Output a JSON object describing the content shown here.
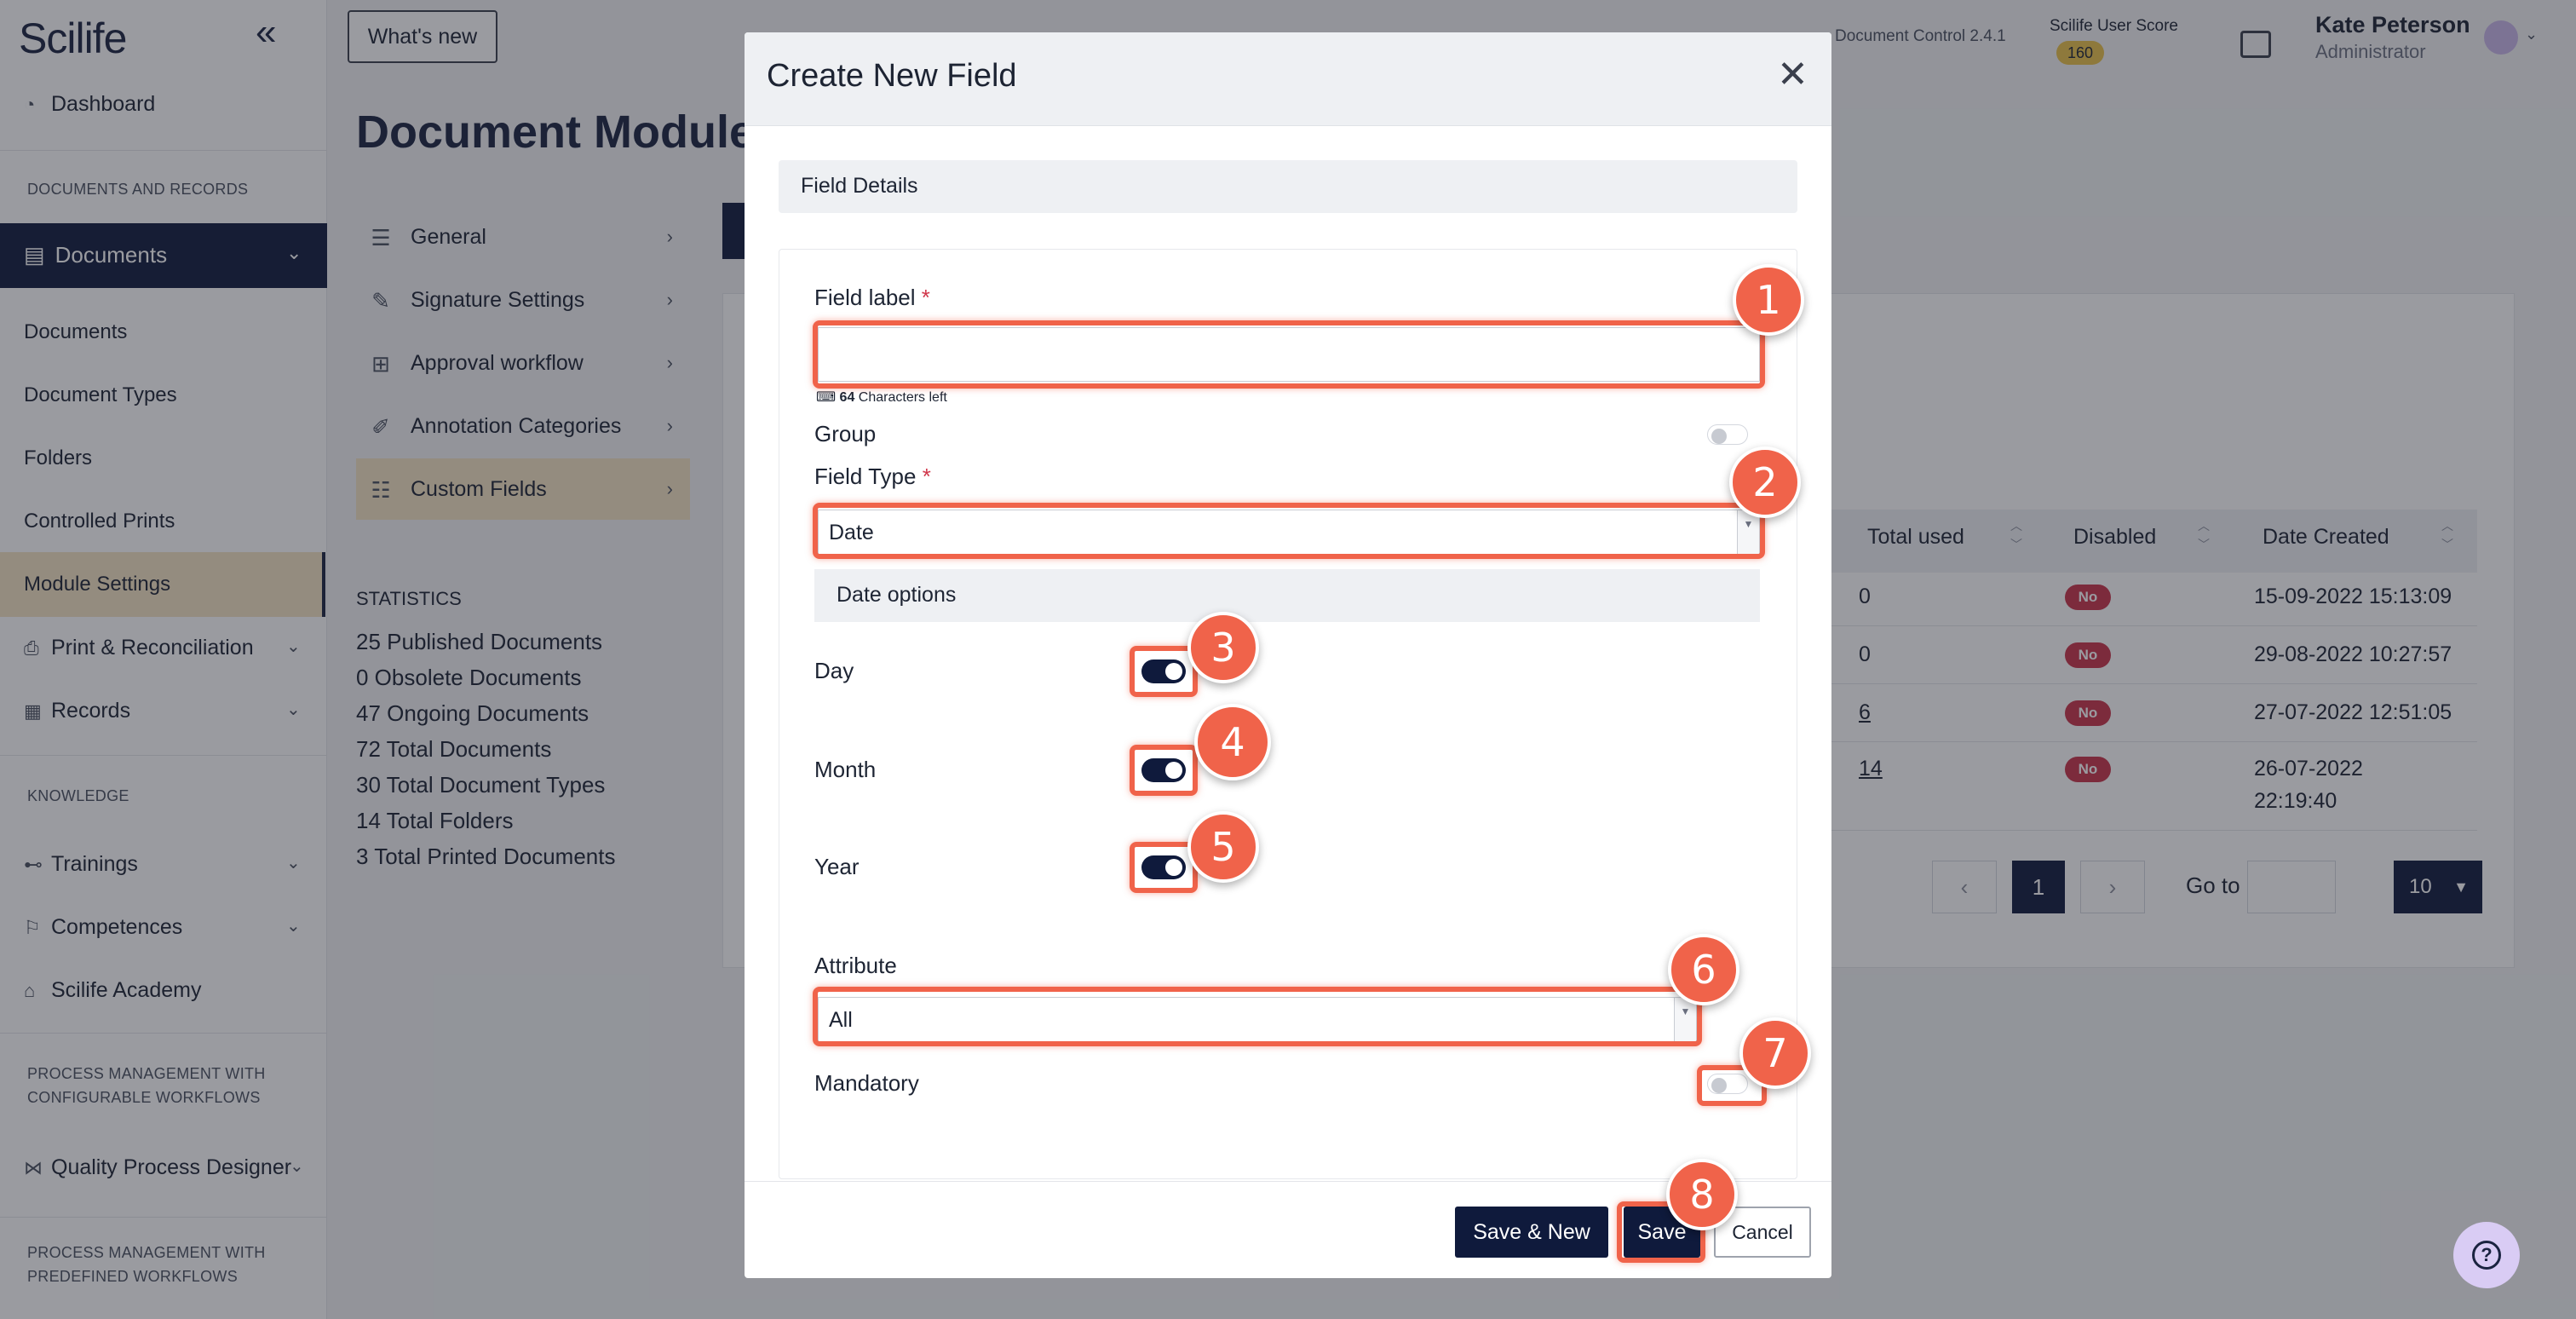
{
  "sidebar": {
    "logo": "Scilife",
    "dashboard": "Dashboard",
    "section_docs": "DOCUMENTS AND RECORDS",
    "documents_group": "Documents",
    "sub_items": [
      "Documents",
      "Document Types",
      "Folders",
      "Controlled Prints",
      "Module Settings"
    ],
    "print_reconciliation": "Print & Reconciliation",
    "records": "Records",
    "section_knowledge": "KNOWLEDGE",
    "trainings": "Trainings",
    "competences": "Competences",
    "academy": "Scilife Academy",
    "section_process_config": "PROCESS MANAGEMENT WITH CONFIGURABLE WORKFLOWS",
    "quality_process_designer": "Quality Process Designer",
    "section_process_predefined": "PROCESS MANAGEMENT WITH PREDEFINED WORKFLOWS"
  },
  "header": {
    "whats_new": "What's new",
    "version": "Document Control 2.4.1",
    "user_score_label": "Scilife User Score",
    "user_score": "160",
    "user_name": "Kate Peterson",
    "user_role": "Administrator"
  },
  "page": {
    "title": "Document Module",
    "settings_menu": [
      "General",
      "Signature Settings",
      "Approval workflow",
      "Annotation Categories",
      "Custom Fields"
    ],
    "stats_title": "STATISTICS",
    "stats": [
      "25  Published Documents",
      "0  Obsolete Documents",
      "47  Ongoing Documents",
      "72  Total Documents",
      "30  Total Document Types",
      "14  Total Folders",
      "3  Total Printed Documents"
    ],
    "table": {
      "headers": [
        "Total used",
        "Disabled",
        "Date Created"
      ],
      "rows": [
        {
          "total_used": "0",
          "disabled": "No",
          "date_created": "15-09-2022 15:13:09"
        },
        {
          "total_used": "0",
          "disabled": "No",
          "date_created": "29-08-2022 10:27:57"
        },
        {
          "total_used": "6",
          "disabled": "No",
          "date_created": "27-07-2022 12:51:05"
        },
        {
          "total_used": "14",
          "disabled": "No",
          "date_created": "26-07-2022",
          "date_created_2": "22:19:40"
        }
      ]
    },
    "pagination": {
      "current": "1",
      "goto_label": "Go to",
      "per_page": "10"
    }
  },
  "modal": {
    "title": "Create New Field",
    "section": "Field Details",
    "field_label": "Field label",
    "required_mark": "*",
    "field_label_value": "",
    "chars_left_count": "64",
    "chars_left_text": "Characters left",
    "group_label": "Group",
    "field_type_label": "Field Type",
    "field_type_value": "Date",
    "date_options": "Date options",
    "day": "Day",
    "month": "Month",
    "year": "Year",
    "attribute_label": "Attribute",
    "attribute_value": "All",
    "mandatory_label": "Mandatory",
    "toggles": {
      "group": false,
      "day": true,
      "month": true,
      "year": true,
      "mandatory": false
    },
    "save_new": "Save & New",
    "save": "Save",
    "cancel": "Cancel"
  },
  "annotations": [
    "1",
    "2",
    "3",
    "4",
    "5",
    "6",
    "7",
    "8"
  ],
  "colors": {
    "primary": "#0f1a3c",
    "highlight": "#f0634a",
    "active_menu": "#f5e3c3",
    "badge_no": "#c8344a"
  }
}
